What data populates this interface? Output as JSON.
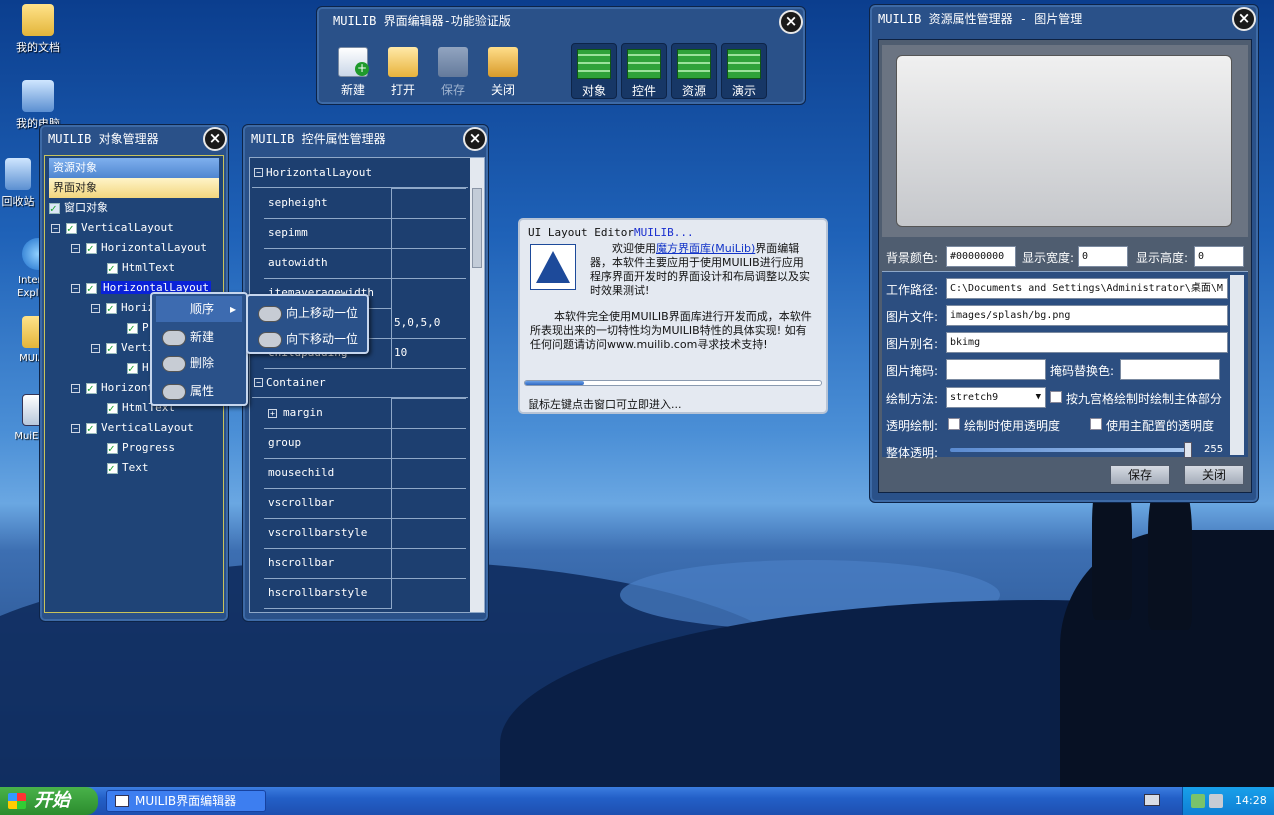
{
  "desktop_icons": [
    {
      "label": "我的文档",
      "icon": "documents-folder-icon"
    },
    {
      "label": "我的电脑",
      "icon": "my-computer-icon"
    },
    {
      "label": "回收站",
      "icon": "recycle-bin-icon"
    },
    {
      "label": "Internet Explorer",
      "icon": "internet-explorer-icon"
    },
    {
      "label": "MUIAPP",
      "icon": "folder-icon"
    },
    {
      "label": "MuiEditor",
      "icon": "application-icon"
    }
  ],
  "toolbar_window": {
    "title": "MUILIB 界面编辑器-功能验证版",
    "buttons": {
      "new": "新建",
      "open": "打开",
      "save": "保存",
      "close": "关闭"
    },
    "groups": {
      "objects": "对象",
      "controls": "控件",
      "resources": "资源",
      "demo": "演示"
    }
  },
  "object_manager": {
    "title": "MUILIB 对象管理器",
    "resource_objects": "资源对象",
    "ui_objects": "界面对象",
    "window_objects": "窗口对象",
    "nodes": {
      "n1": "VerticalLayout",
      "n2": "HorizontalLayout",
      "n3": "HtmlText",
      "n4": "HorizontalLayout",
      "n5": "HorizontalLayout",
      "n6": "P",
      "n7": "VerticalLayout",
      "n8": "H",
      "n9": "HorizontalLayout",
      "n10": "HtmlText",
      "n11": "VerticalLayout",
      "n12": "Progress",
      "n13": "Text"
    }
  },
  "context_menu": {
    "order": "顺序",
    "new": "新建",
    "delete": "删除",
    "properties": "属性",
    "move_up": "向上移动一位",
    "move_down": "向下移动一位"
  },
  "property_manager": {
    "title": "MUILIB 控件属性管理器",
    "cat_horizontal": "HorizontalLayout",
    "cat_container": "Container",
    "props": {
      "sepheight": "sepheight",
      "sepimm": "sepimm",
      "autowidth": "autowidth",
      "itemaveragewidth": "itemaveragewidth",
      "margin_label": "margin",
      "margin_value": "5,0,5,0",
      "childpadding": "childpadding",
      "childpadding_value": "10",
      "margin2": "margin",
      "group": "group",
      "mousechild": "mousechild",
      "vscrollbar": "vscrollbar",
      "vscrollbarstyle": "vscrollbarstyle",
      "hscrollbar": "hscrollbar",
      "hscrollbarstyle": "hscrollbarstyle"
    }
  },
  "splash": {
    "title_plain": "UI Layout Editor",
    "title_brand": "MUILIB...",
    "p1_before": "欢迎使用",
    "p1_link": "魔方界面库(MuiLib)",
    "p1_after": "界面编辑器，本软件主要应用于使用MUILIB进行应用程序界面开发时的界面设计和布局调整以及实时效果测试!",
    "p2": "本软件完全使用MUILIB界面库进行开发而成，本软件所表现出来的一切特性均为MUILIB特性的具体实现! 如有任何问题请访问www.muilib.com寻求技术支持!",
    "progress": 0.2,
    "footer": "鼠标左键点击窗口可立即进入..."
  },
  "resource_manager": {
    "title": "MUILIB 资源属性管理器 - 图片管理",
    "bg_color_label": "背景颜色:",
    "bg_color_value": "#00000000",
    "width_label": "显示宽度:",
    "width_value": "0",
    "height_label": "显示高度:",
    "height_value": "0",
    "work_path_label": "工作路径:",
    "work_path_value": "C:\\Documents and Settings\\Administrator\\桌面\\M",
    "image_file_label": "图片文件:",
    "image_file_value": "images/splash/bg.png",
    "image_alias_label": "图片别名:",
    "image_alias_value": "bkimg",
    "mask_label": "图片掩码:",
    "mask_value": "",
    "mask_replace_label": "掩码替换色:",
    "mask_replace_value": "",
    "draw_method_label": "绘制方法:",
    "draw_method_value": "stretch9",
    "ninegrid_label": "按九宫格绘制时绘制主体部分",
    "transparent_label": "透明绘制:",
    "use_transparency": "绘制时使用透明度",
    "use_main_transparency": "使用主配置的透明度",
    "opacity_label": "整体透明:",
    "opacity_value": "255",
    "save": "保存",
    "close": "关闭"
  },
  "taskbar": {
    "start": "开始",
    "task": "MUILIB界面编辑器",
    "clock": "14:28"
  }
}
